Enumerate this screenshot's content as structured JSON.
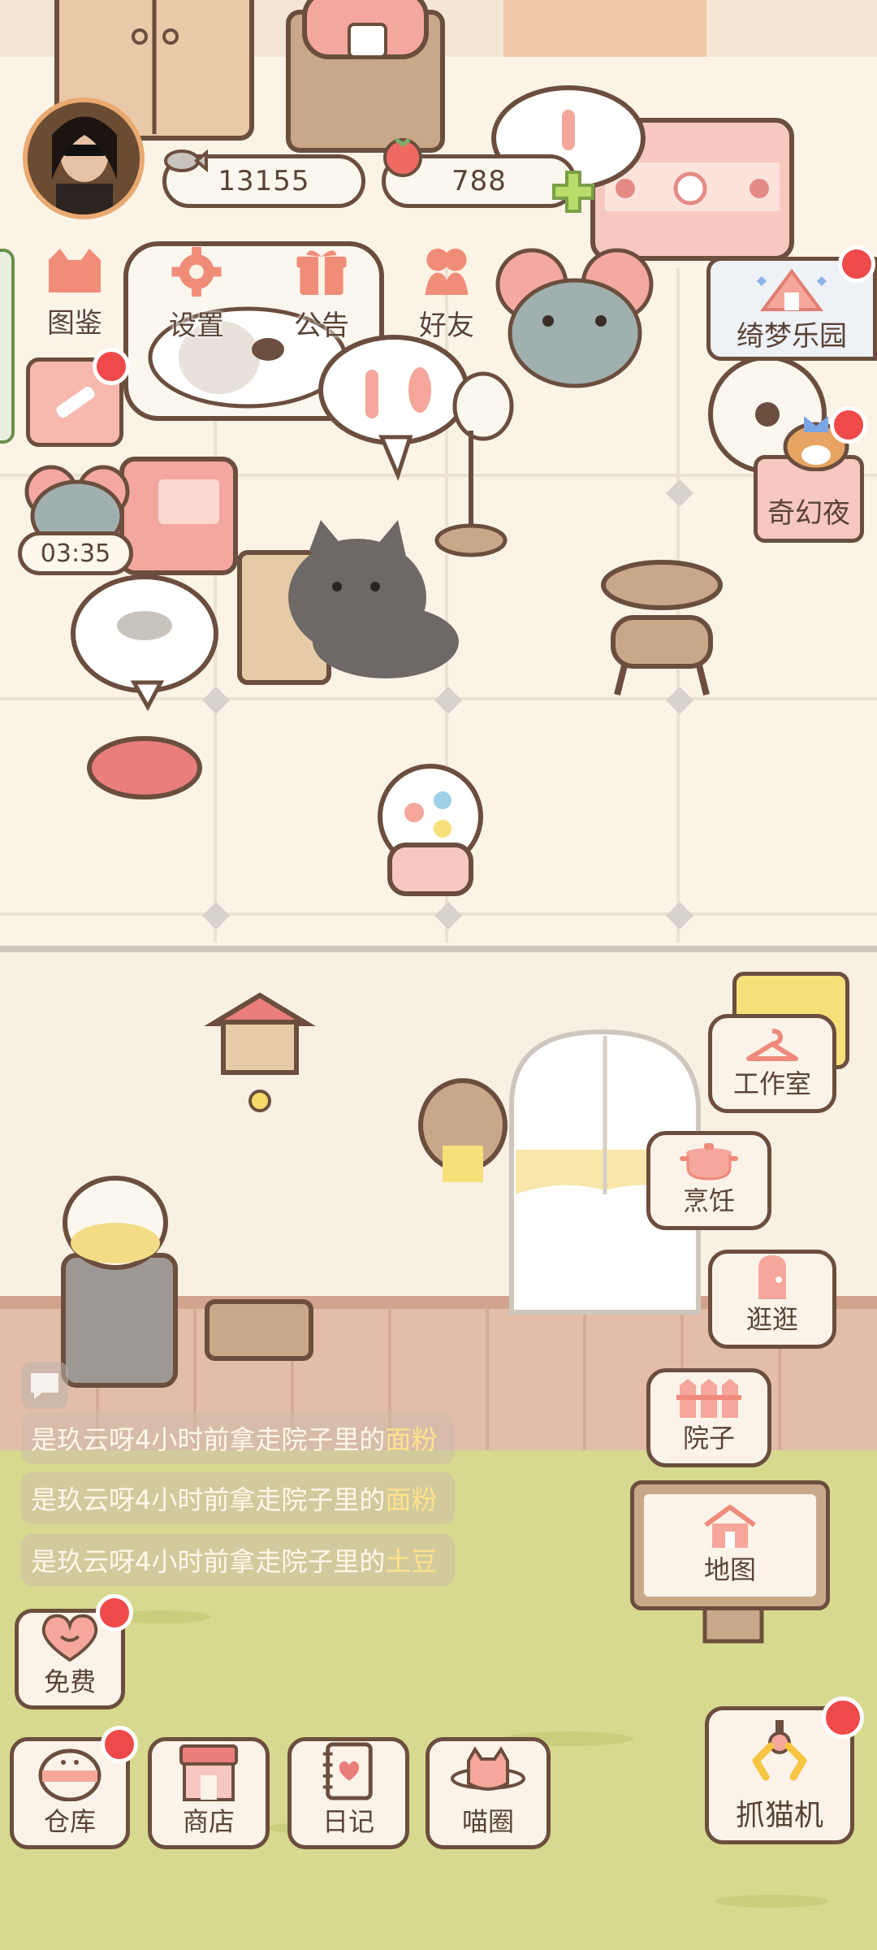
{
  "hud": {
    "fish_count": "13155",
    "heart_count": "788"
  },
  "top_menu": [
    {
      "label": "图鉴"
    },
    {
      "label": "设置"
    },
    {
      "label": "公告"
    },
    {
      "label": "好友"
    }
  ],
  "events": {
    "dream_park": "绮梦乐园",
    "fantasy_night": "奇幻夜"
  },
  "mouse_timer": "03:35",
  "side_buttons": {
    "studio": "工作室",
    "cooking": "烹饪",
    "stroll": "逛逛",
    "yard": "院子",
    "map": "地图"
  },
  "messages": [
    {
      "prefix": "是玖云呀4小时前拿走院子里的",
      "item": "面粉"
    },
    {
      "prefix": "是玖云呀4小时前拿走院子里的",
      "item": "面粉"
    },
    {
      "prefix": "是玖云呀4小时前拿走院子里的",
      "item": "土豆"
    }
  ],
  "bottom_bar": {
    "free": "免费",
    "warehouse": "仓库",
    "shop": "商店",
    "diary": "日记",
    "meow_circle": "喵圈",
    "claw_machine": "抓猫机"
  },
  "colors": {
    "accent_pink": "#f4a79a",
    "outline_brown": "#6b4e3e",
    "notification_red": "#ef4a4a",
    "message_highlight": "#ffe28a"
  }
}
